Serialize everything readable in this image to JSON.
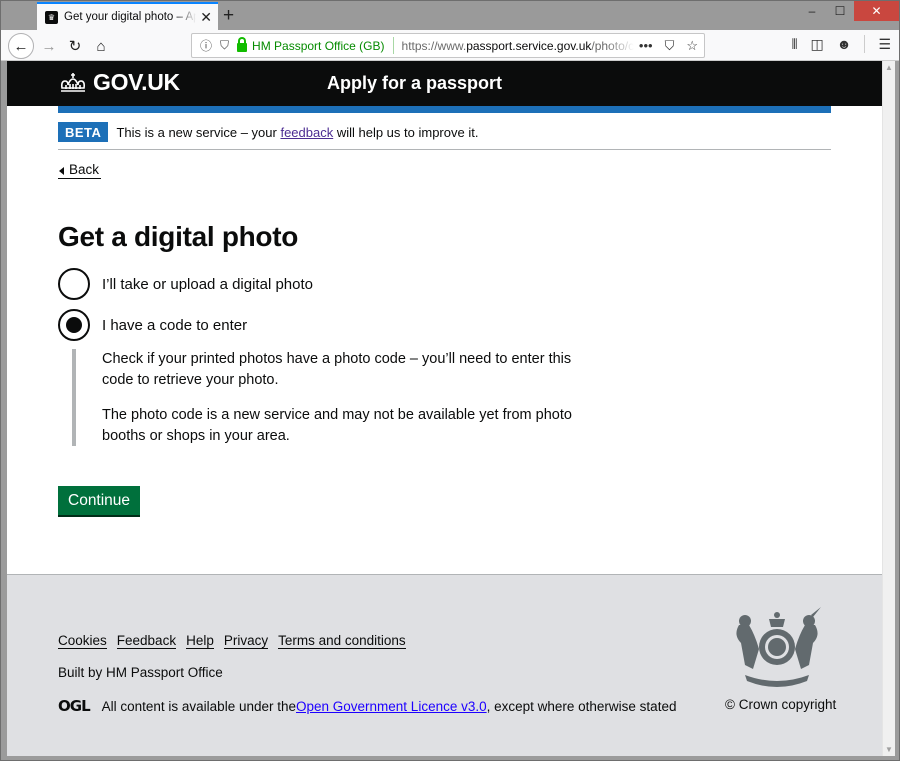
{
  "browser": {
    "tab_title": "Get your digital photo – Apply for a passport",
    "identity": "HM Passport Office (GB)",
    "url_prefix": "https://www.",
    "url_domain": "passport.service.gov.uk",
    "url_path": "/photo/choose",
    "url_more": "•••"
  },
  "header": {
    "logo_text": "GOV.UK",
    "service_name": "Apply for a passport"
  },
  "beta": {
    "tag": "BETA",
    "text_before": "This is a new service – your ",
    "link": "feedback",
    "text_after": " will help us to improve it."
  },
  "back_label": "Back",
  "page": {
    "heading": "Get a digital photo",
    "options": [
      {
        "label": "I’ll take or upload a digital photo",
        "checked": false
      },
      {
        "label": "I have a code to enter",
        "checked": true
      }
    ],
    "conditional": [
      "Check if your printed photos have a photo code – you’ll need to enter this code to retrieve your photo.",
      "The photo code is a new service and may not be available yet from photo booths or shops in your area."
    ],
    "continue_label": "Continue"
  },
  "footer": {
    "links": [
      "Cookies",
      "Feedback",
      "Help",
      "Privacy",
      "Terms and conditions"
    ],
    "built_by": "Built by HM Passport Office",
    "ogl_logo": "OGL",
    "licence_before": "All content is available under the ",
    "licence_link": "Open Government Licence v3.0",
    "licence_after": ", except where otherwise stated",
    "copyright": "© Crown copyright"
  },
  "colors": {
    "govuk_black": "#0b0c0c",
    "govuk_blue": "#1d70b8",
    "button_green": "#00703c",
    "footer_bg": "#dfe0e3"
  }
}
